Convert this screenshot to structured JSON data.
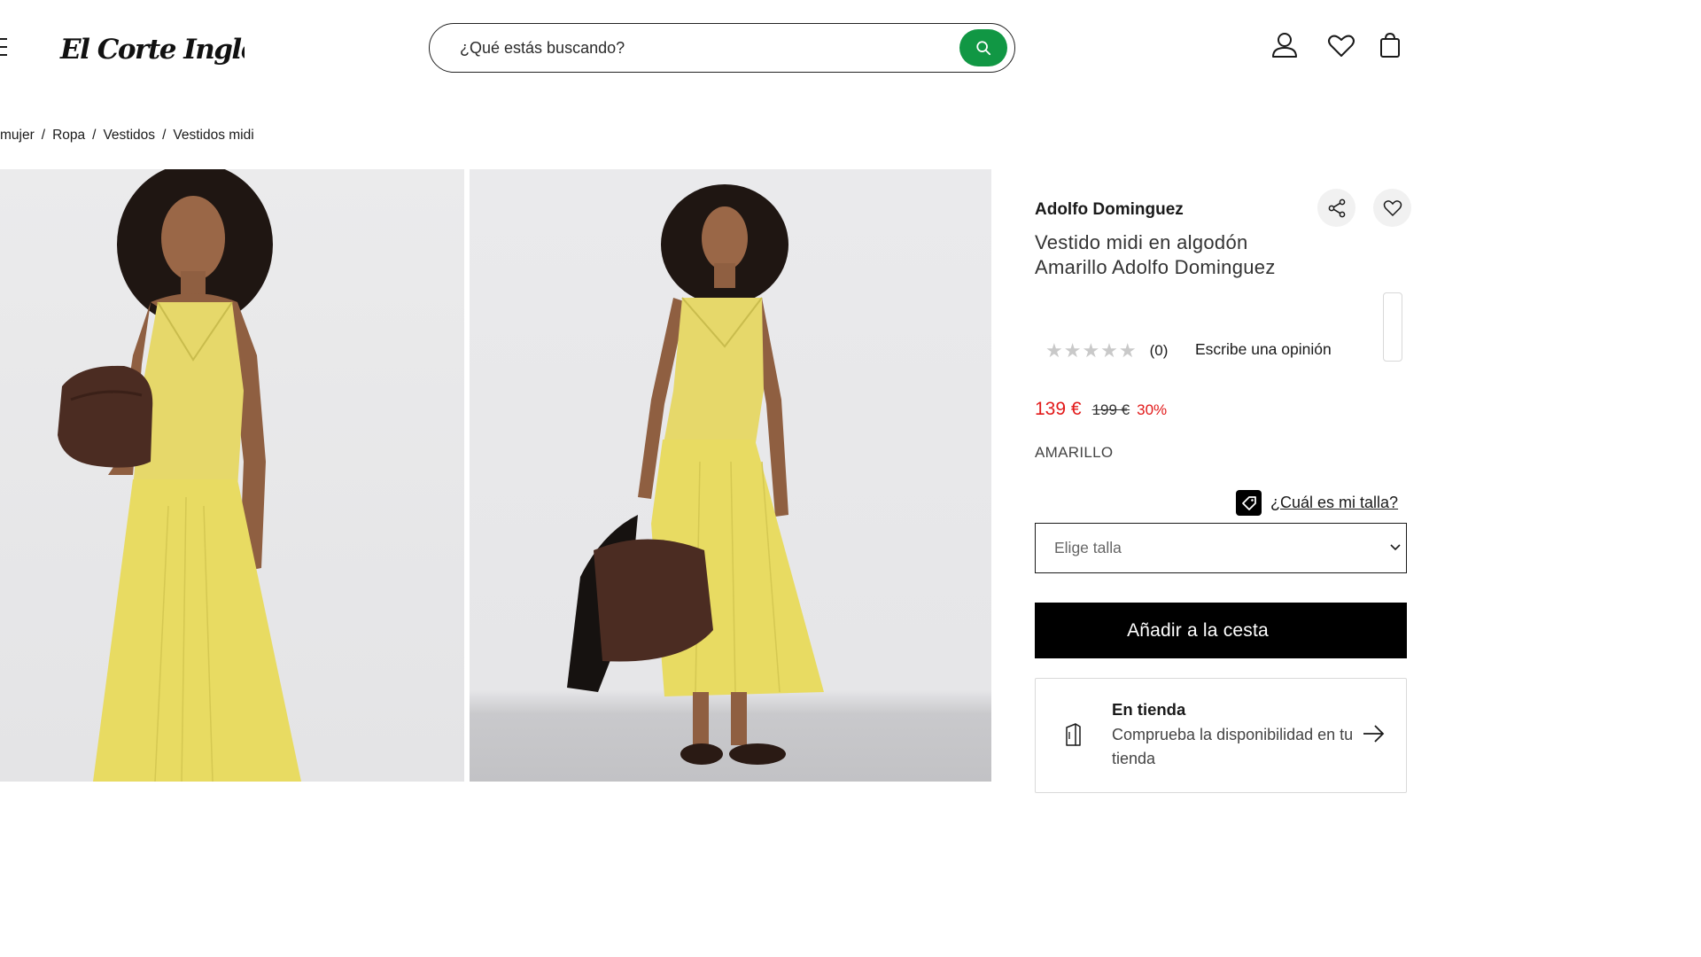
{
  "header": {
    "logo_text": "El Corte Inglés",
    "search": {
      "placeholder": "¿Qué estás buscando?"
    },
    "icons": [
      "menu-icon",
      "search-icon",
      "user-icon",
      "heart-icon",
      "bag-icon"
    ]
  },
  "breadcrumb": {
    "items": [
      "mujer",
      "Ropa",
      "Vestidos",
      "Vestidos midi"
    ],
    "separator": "/"
  },
  "product": {
    "brand": "Adolfo Dominguez",
    "title": "Vestido midi en algodón Amarillo Adolfo Dominguez",
    "rating": {
      "stars": "★★★★★",
      "count": "(0)",
      "write_review": "Escribe una opinión"
    },
    "price": {
      "current": "139 €",
      "original": "199 €",
      "discount": "30%"
    },
    "color": "AMARILLO",
    "size_guide": "¿Cuál es mi talla?",
    "size_select_placeholder": "Elige talla",
    "add_to_cart": "Añadir a la cesta",
    "store": {
      "title": "En tienda",
      "subtitle": "Comprueba la disponibilidad en tu tienda"
    }
  },
  "colors": {
    "brand_green": "#119744",
    "sale_red": "#e21a1a",
    "button_black": "#000000",
    "dress_yellow": "#e8db62"
  }
}
